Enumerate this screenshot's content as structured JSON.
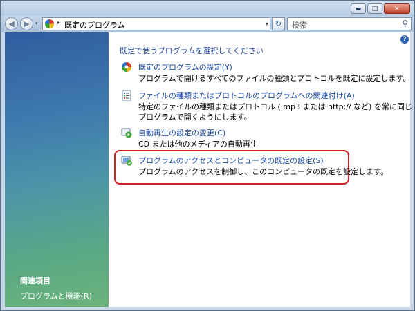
{
  "window": {
    "title_buttons": {
      "minimize": "▬",
      "maximize": "□",
      "close": "✕"
    }
  },
  "navbar": {
    "back_glyph": "◀",
    "forward_glyph": "▶",
    "address_separator": "▸",
    "address_text": "既定のプログラム",
    "address_dropdown": "▾",
    "refresh_glyph": "↻",
    "search_placeholder": "検索",
    "search_glyph": "⚲"
  },
  "left_pane": {
    "related_title": "関連項目",
    "related_link": "プログラムと機能(R)"
  },
  "content": {
    "help_glyph": "?",
    "heading": "既定で使うプログラムを選択してください",
    "tasks": [
      {
        "icon": "default-programs-icon",
        "link": "既定のプログラムの設定(Y)",
        "desc": "プログラムで開けるすべてのファイルの種類とプロトコルを既定に設定します。"
      },
      {
        "icon": "file-association-icon",
        "link": "ファイルの種類またはプロトコルのプログラムへの関連付け(A)",
        "desc": "特定のファイルの種類またはプロトコル (.mp3 または http:// など) を常に同じプログラムで開くようにします。"
      },
      {
        "icon": "autoplay-icon",
        "link": "自動再生の設定の変更(C)",
        "desc": "CD または他のメディアの自動再生"
      },
      {
        "icon": "program-access-icon",
        "link": "プログラムのアクセスとコンピュータの既定の設定(S)",
        "desc": "プログラムのアクセスを制御し、このコンピュータの既定を設定します。"
      }
    ]
  },
  "colors": {
    "link": "#1a4ba8",
    "heading": "#1c3f94",
    "highlight_border": "#d12020"
  }
}
